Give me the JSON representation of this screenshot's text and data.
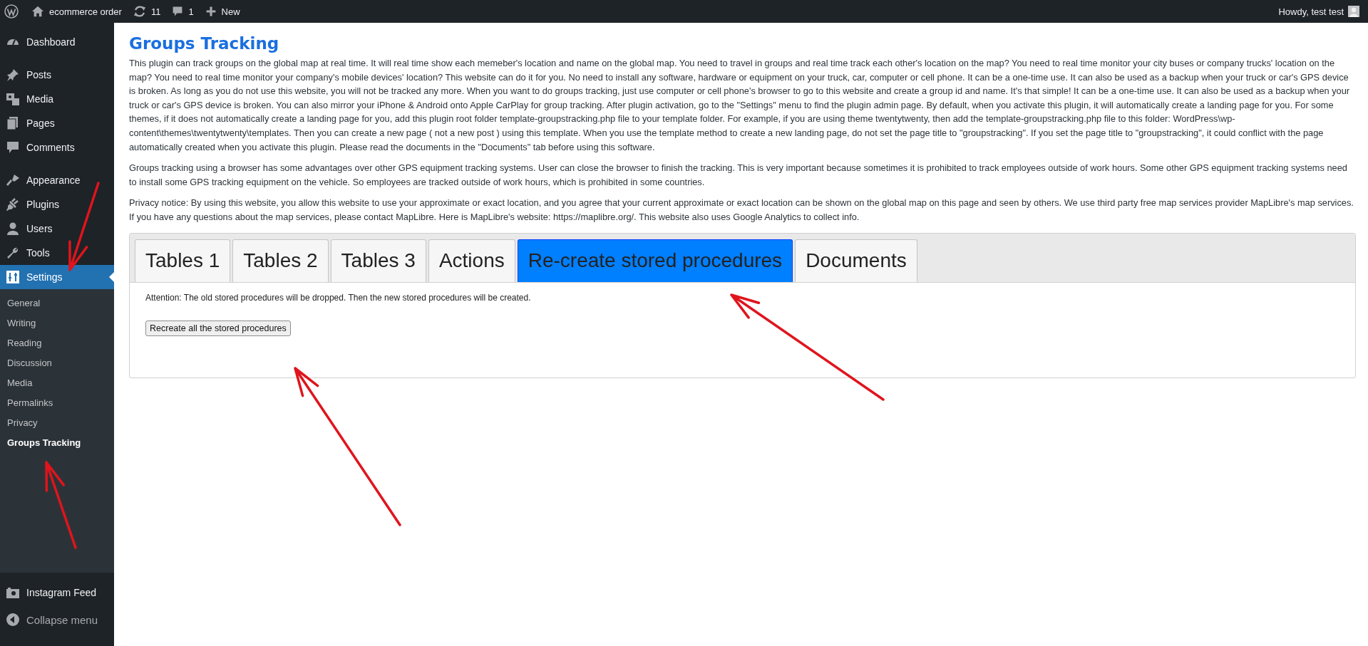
{
  "admin_bar": {
    "items": [
      {
        "kind": "logo"
      },
      {
        "kind": "home",
        "label": "ecommerce order"
      },
      {
        "kind": "updates",
        "label": "11"
      },
      {
        "kind": "comments",
        "label": "1"
      },
      {
        "kind": "new",
        "label": "New"
      }
    ],
    "greeting": "Howdy, test test"
  },
  "sidebar": {
    "sections": [
      {
        "items": [
          {
            "label": "Dashboard",
            "selected": false
          }
        ]
      },
      {
        "items": [
          {
            "label": "Posts",
            "selected": false
          },
          {
            "label": "Media",
            "selected": false
          },
          {
            "label": "Pages",
            "selected": false
          },
          {
            "label": "Comments",
            "selected": false
          }
        ]
      },
      {
        "items": [
          {
            "label": "Appearance",
            "selected": false
          },
          {
            "label": "Plugins",
            "selected": false
          },
          {
            "label": "Users",
            "selected": false
          },
          {
            "label": "Tools",
            "selected": false
          },
          {
            "label": "Settings",
            "selected": true,
            "children": [
              {
                "label": "General",
                "selected": false
              },
              {
                "label": "Writing",
                "selected": false
              },
              {
                "label": "Reading",
                "selected": false
              },
              {
                "label": "Discussion",
                "selected": false
              },
              {
                "label": "Media",
                "selected": false
              },
              {
                "label": "Permalinks",
                "selected": false
              },
              {
                "label": "Privacy",
                "selected": false
              },
              {
                "label": "Groups Tracking",
                "selected": true
              }
            ]
          }
        ]
      }
    ],
    "footer": [
      {
        "kind": "plugin",
        "label": "Instagram Feed"
      },
      {
        "kind": "collapse",
        "label": "Collapse menu"
      }
    ]
  },
  "page": {
    "title": "Groups Tracking",
    "paragraphs": [
      "This plugin can track groups on the global map at real time. It will real time show each memeber's location and name on the global map. You need to travel in groups and real time track each other's location on the map? You need to real time monitor your city buses or company trucks' location on the map? You need to real time monitor your company's mobile devices' location? This website can do it for you. No need to install any software, hardware or equipment on your truck, car, computer or cell phone. It can be a one-time use. It can also be used as a backup when your truck or car's GPS device is broken. As long as you do not use this website, you will not be tracked any more. When you want to do groups tracking, just use computer or cell phone's browser to go to this website and create a group id and name. It's that simple! It can be a one-time use. It can also be used as a backup when your truck or car's GPS device is broken. You can also mirror your iPhone & Android onto Apple CarPlay for group tracking. After plugin activation, go to the \"Settings\" menu to find the plugin admin page. By default, when you activate this plugin, it will automatically create a landing page for you. For some themes, if it does not automatically create a landing page for you, add this plugin root folder template-groupstracking.php file to your template folder. For example, if you are using theme twentytwenty, then add the template-groupstracking.php file to this folder: WordPress\\wp-content\\themes\\twentytwenty\\templates. Then you can create a new page ( not a new post ) using this template. When you use the template method to create a new landing page, do not set the page title to \"groupstracking\". If you set the page title to \"groupstracking\", it could conflict with the page automatically created when you activate this plugin. Please read the documents in the \"Documents\" tab before using this software.",
      "Groups tracking using a browser has some advantages over other GPS equipment tracking systems. User can close the browser to finish the tracking. This is very important because sometimes it is prohibited to track employees outside of work hours. Some other GPS equipment tracking systems need to install some GPS tracking equipment on the vehicle. So employees are tracked outside of work hours, which is prohibited in some countries.",
      "Privacy notice: By using this website, you allow this website to use your approximate or exact location, and you agree that your current approximate or exact location can be shown on the global map on this page and seen by others. We use third party free map services provider MapLibre's map services. If you have any questions about the map services, please contact MapLibre. Here is MapLibre's website: https://maplibre.org/. This website also uses Google Analytics to collect info."
    ]
  },
  "tabs": [
    {
      "label": "Tables 1",
      "selected": false
    },
    {
      "label": "Tables 2",
      "selected": false
    },
    {
      "label": "Tables 3",
      "selected": false
    },
    {
      "label": "Actions",
      "selected": false
    },
    {
      "label": "Re-create stored procedures",
      "selected": true
    },
    {
      "label": "Documents",
      "selected": false
    }
  ],
  "panel": {
    "notice": "Attention: The old stored procedures will be dropped. Then the new stored procedures will be created.",
    "button": "Recreate all the stored procedures"
  },
  "annotations": [
    {
      "kind": "arrow"
    },
    {
      "kind": "arrow"
    },
    {
      "kind": "arrow"
    },
    {
      "kind": "arrow"
    }
  ]
}
